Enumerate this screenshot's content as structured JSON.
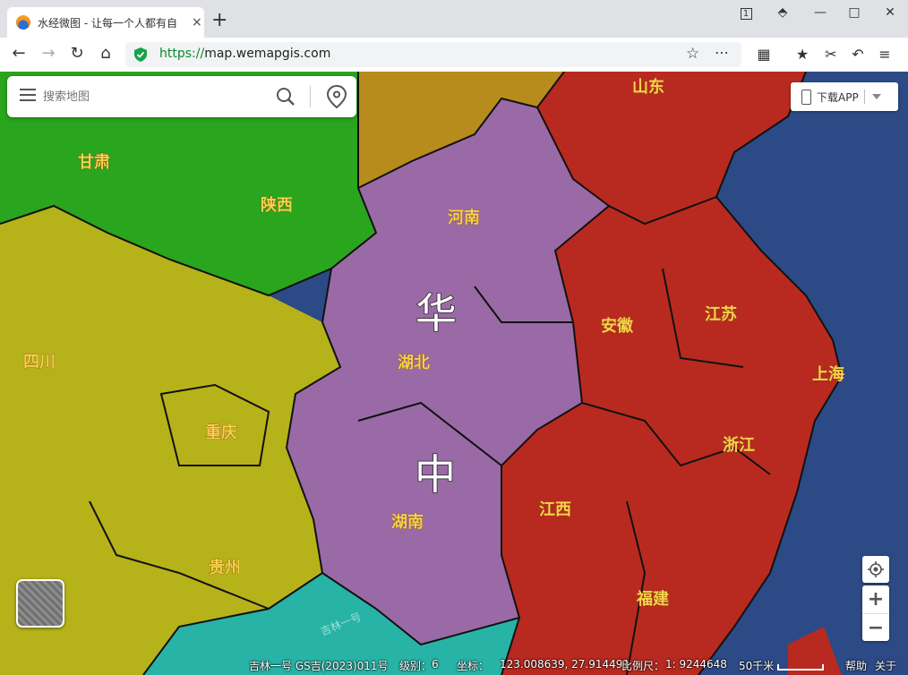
{
  "browser": {
    "tab_title": "水经微图 - 让每一个人都有自",
    "tab_close": "×",
    "new_tab": "+",
    "tab_counter": "1",
    "url_scheme": "https://",
    "url_host": "map.wemapgis.com"
  },
  "search": {
    "placeholder": "搜索地图"
  },
  "download": {
    "label": "下载APP"
  },
  "map": {
    "provinces": [
      {
        "name": "山东",
        "color": "#b82a1f"
      },
      {
        "name": "甘肃",
        "color": "#2aa51e"
      },
      {
        "name": "陕西",
        "color": "#2aa51e"
      },
      {
        "name": "河南",
        "color": "#9a6aa6"
      },
      {
        "name": "湖北",
        "color": "#9a6aa6"
      },
      {
        "name": "湖南",
        "color": "#9a6aa6"
      },
      {
        "name": "安徽",
        "color": "#b82a1f"
      },
      {
        "name": "江苏",
        "color": "#b82a1f"
      },
      {
        "name": "上海",
        "color": "#b82a1f"
      },
      {
        "name": "浙江",
        "color": "#b82a1f"
      },
      {
        "name": "江西",
        "color": "#b82a1f"
      },
      {
        "name": "福建",
        "color": "#b82a1f"
      },
      {
        "name": "四川",
        "color": "#b6b21a"
      },
      {
        "name": "重庆",
        "color": "#b6b21a"
      },
      {
        "name": "贵州",
        "color": "#b6b21a"
      }
    ],
    "region_chars": [
      "华",
      "中"
    ],
    "overlay_text": "吉林一号"
  },
  "status": {
    "source": "吉林一号 GS吉(2023)011号",
    "level_label": "级别：",
    "level": "6",
    "coord_label": "坐标：",
    "coords": "123.008639, 27.914491",
    "scale_label": "比例尺：",
    "scale_ratio": "1: 9244648",
    "scale_distance": "50千米",
    "help": "帮助",
    "about": "关于"
  }
}
